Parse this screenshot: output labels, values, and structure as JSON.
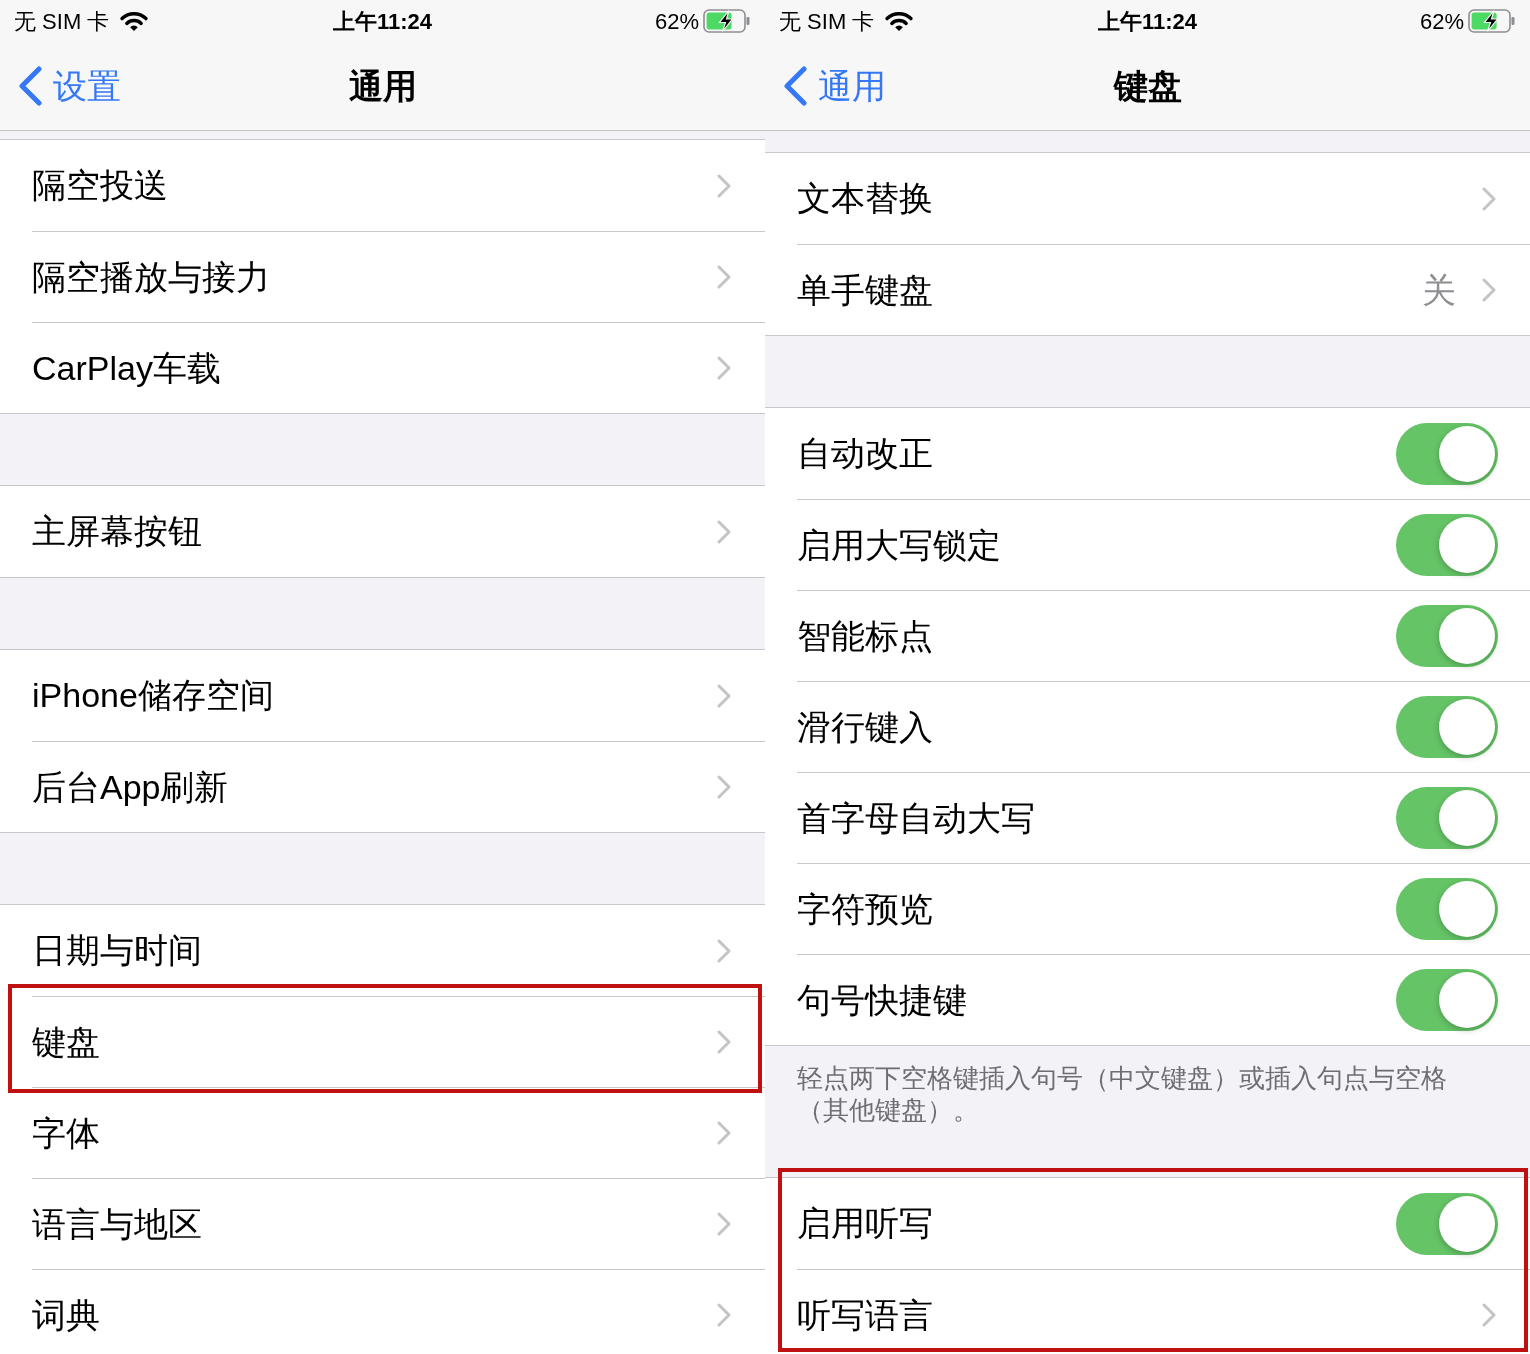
{
  "screens": [
    {
      "status_bar": {
        "carrier": "无 SIM 卡",
        "time": "上午11:24",
        "battery": "62%"
      },
      "nav_bar": {
        "back": "设置",
        "title": "通用"
      },
      "groups": [
        {
          "items": [
            {
              "kind": "link",
              "label": "隔空投送",
              "highlighted": false
            },
            {
              "kind": "link",
              "label": "隔空播放与接力",
              "highlighted": false
            },
            {
              "kind": "link",
              "label": "CarPlay车载",
              "highlighted": false
            }
          ]
        },
        {
          "items": [
            {
              "kind": "link",
              "label": "主屏幕按钮",
              "highlighted": false
            }
          ]
        },
        {
          "items": [
            {
              "kind": "link",
              "label": "iPhone储存空间",
              "highlighted": false
            },
            {
              "kind": "link",
              "label": "后台App刷新",
              "highlighted": false
            }
          ]
        },
        {
          "items": [
            {
              "kind": "link",
              "label": "日期与时间",
              "highlighted": false
            },
            {
              "kind": "link",
              "label": "键盘",
              "highlighted": true
            },
            {
              "kind": "link",
              "label": "字体",
              "highlighted": false
            },
            {
              "kind": "link",
              "label": "语言与地区",
              "highlighted": false
            },
            {
              "kind": "link",
              "label": "词典",
              "highlighted": false
            }
          ]
        }
      ]
    },
    {
      "status_bar": {
        "carrier": "无 SIM 卡",
        "time": "上午11:24",
        "battery": "62%"
      },
      "nav_bar": {
        "back": "通用",
        "title": "键盘"
      },
      "groups": [
        {
          "items": [
            {
              "kind": "link",
              "label": "文本替换",
              "highlighted": false
            },
            {
              "kind": "link",
              "label": "单手键盘",
              "value": "关",
              "highlighted": false
            }
          ]
        },
        {
          "items": [
            {
              "kind": "toggle",
              "label": "自动改正",
              "on": true,
              "highlighted": false
            },
            {
              "kind": "toggle",
              "label": "启用大写锁定",
              "on": true,
              "highlighted": false
            },
            {
              "kind": "toggle",
              "label": "智能标点",
              "on": true,
              "highlighted": false
            },
            {
              "kind": "toggle",
              "label": "滑行键入",
              "on": true,
              "highlighted": false
            },
            {
              "kind": "toggle",
              "label": "首字母自动大写",
              "on": true,
              "highlighted": false
            },
            {
              "kind": "toggle",
              "label": "字符预览",
              "on": true,
              "highlighted": false
            },
            {
              "kind": "toggle",
              "label": "句号快捷键",
              "on": true,
              "highlighted": false
            }
          ],
          "footer": "轻点两下空格键插入句号（中文键盘）或插入句点与空格（其他键盘）。"
        },
        {
          "items": [
            {
              "kind": "toggle",
              "label": "启用听写",
              "on": true,
              "highlighted": true
            },
            {
              "kind": "link",
              "label": "听写语言",
              "highlighted": true
            }
          ]
        }
      ]
    }
  ]
}
